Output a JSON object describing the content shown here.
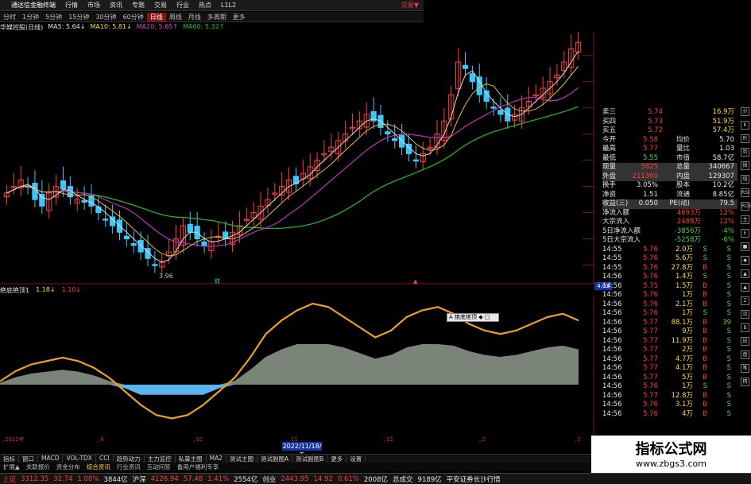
{
  "topbar": {
    "brand": "通达信金融终端",
    "items": [
      "行情",
      "市场",
      "资讯",
      "专题",
      "交易",
      "行业",
      "热点",
      "L1L2"
    ],
    "trade": "交易▼"
  },
  "periods": [
    "分时",
    "1分钟",
    "5分钟",
    "15分钟",
    "30分钟",
    "60分钟",
    "日线",
    "周线",
    "月线",
    "多周期",
    "更多"
  ],
  "active_period": "日线",
  "ma_legend": {
    "stock": "华媒控股(日线)",
    "ma5": "MA5: 5.64↓",
    "ma10": "MA10: 5.81↓",
    "ma20": "MA20: 5.65↑",
    "ma60": "MA60: 5.32↑"
  },
  "colors": {
    "up": "#ff3d3d",
    "down": "#3cc8ff",
    "ma5": "#e6e6e6",
    "ma10": "#ffdc3c",
    "ma20": "#e040e0",
    "ma60": "#22b422",
    "indicator": "#f0a020",
    "area": "#7a8478",
    "neg": "#5ab4f0"
  },
  "axis": {
    "price_ticks": [
      "5.60",
      "5.40",
      "5.20",
      "5.00",
      "4.80",
      "4.60",
      "4.40",
      "4.20",
      "4.00"
    ],
    "low_label": "3.96",
    "price_tag": "4.03",
    "ind_ticks": [
      "1.00",
      "0.75",
      "0.50",
      "0.25",
      "0.00",
      "-0.25",
      "-0.50"
    ],
    "dates": [
      "2022年",
      "8",
      "10",
      "11",
      "12",
      "2",
      "3"
    ],
    "date_cursor": "2022/11/18/五"
  },
  "indicator_legend": {
    "name": "绝底绝顶1",
    "v1": "1.18↓",
    "v2": "1.10↓"
  },
  "tooltip": "A 绝底绝顶 ◆ □",
  "tabs1": [
    "指标",
    "窗口",
    "MACD",
    "VOL-TDX",
    "CCI",
    "趋势动力",
    "主力监控",
    "私募主图",
    "MA2",
    "测试主图",
    "测试副图A",
    "测试副图B",
    "更多",
    "设置"
  ],
  "tabs2": [
    "扩展▲",
    "关联报价",
    "资金分布",
    "综合资讯",
    "行业资讯",
    "互动问答",
    "备用户福利专享"
  ],
  "quote_top": [
    [
      "卖三",
      "5.74",
      "16.9万"
    ],
    [
      "买四",
      "5.73",
      "51.9万"
    ],
    [
      "买五",
      "5.72",
      "57.4万"
    ]
  ],
  "stats": [
    [
      "今开",
      "5.58",
      "均价",
      "5.70"
    ],
    [
      "最高",
      "5.77",
      "量比",
      "1.03"
    ],
    [
      "最低",
      "5.55",
      "市值",
      "58.7亿"
    ],
    [
      "现量",
      "5825",
      "总量",
      "340667"
    ],
    [
      "外盘",
      "211360",
      "内盘",
      "129307"
    ]
  ],
  "stats2": [
    [
      "换手",
      "3.05%",
      "股本",
      "10.2亿"
    ],
    [
      "净资",
      "1.51",
      "流通",
      "8.85亿"
    ],
    [
      "收益(三)",
      "0.050",
      "PE(动)",
      "79.5"
    ]
  ],
  "flows": [
    [
      "净流入额",
      "4693万",
      "12%"
    ],
    [
      "大宗流入",
      "2488万",
      "12%"
    ],
    [
      "5日净流入额",
      "-3856万",
      "-4%"
    ],
    [
      "5日大宗流入",
      "-5258万",
      "-6%"
    ]
  ],
  "ticks": [
    [
      "14:55",
      "5.76",
      "2.0万",
      "S"
    ],
    [
      "14:55",
      "5.76",
      "5.6万",
      "S"
    ],
    [
      "14:55",
      "5.76",
      "27.8万",
      "B"
    ],
    [
      "14:56",
      "5.76",
      "1.4万",
      "S"
    ],
    [
      "14:56",
      "5.75",
      "1.5万",
      "B"
    ],
    [
      "14:56",
      "5.76",
      "1万",
      "B"
    ],
    [
      "14:56",
      "5.76",
      "2.1万",
      "B"
    ],
    [
      "14:56",
      "5.76",
      "1万",
      "S"
    ],
    [
      "14:56",
      "5.77",
      "88.1万",
      "B"
    ],
    [
      "14:56",
      "5.77",
      "9万",
      "B"
    ],
    [
      "14:56",
      "5.77",
      "11.9万",
      "B"
    ],
    [
      "14:56",
      "5.77",
      "2万",
      "B"
    ],
    [
      "14:56",
      "5.77",
      "4.7万",
      "B"
    ],
    [
      "14:56",
      "5.77",
      "4.1万",
      "B"
    ],
    [
      "14:56",
      "5.77",
      "5万",
      "B"
    ],
    [
      "14:56",
      "5.76",
      "1万",
      "S"
    ],
    [
      "14:56",
      "5.77",
      "12.8万",
      "B"
    ],
    [
      "14:56",
      "5.76",
      "3.1万",
      "B"
    ],
    [
      "14:56",
      "5.76",
      "4万",
      "B"
    ]
  ],
  "tick_extra": [
    "S",
    "S",
    "S",
    "S",
    "S",
    "S",
    "S",
    "S",
    "39",
    "S",
    "S",
    "S",
    "S",
    "S",
    "S",
    "S",
    "S",
    "S",
    "S"
  ],
  "sidebar": [
    "分",
    "K",
    "阶",
    "势",
    "操",
    "值",
    "RSI",
    "ROE",
    "主",
    "E",
    "■",
    "◆",
    "▲",
    "▲",
    "Z",
    "流",
    "B",
    "投",
    "盘",
    "笔",
    "精"
  ],
  "bottombar": {
    "sh_label": "上证",
    "sh": "3312.35",
    "sh_chg": "32.74",
    "sh_pct": "1.00%",
    "sh_amt": "3844亿",
    "sz_label": "沪深",
    "sz": "4126.94",
    "sz_chg": "57.48",
    "sz_pct": "1.41%",
    "sz_amt": "2554亿",
    "cy_label": "创业",
    "cy": "2443.95",
    "cy_chg": "14.92",
    "cy_pct": "0.61%",
    "cy_amt": "2008亿",
    "total_label": "总成交",
    "total": "9189亿",
    "broker": "平安证券长沙行情"
  },
  "watermark": {
    "title": "指标公式网",
    "url": "www.zbgs3.com"
  },
  "corner": "图文F10",
  "corner2": "模板"
}
